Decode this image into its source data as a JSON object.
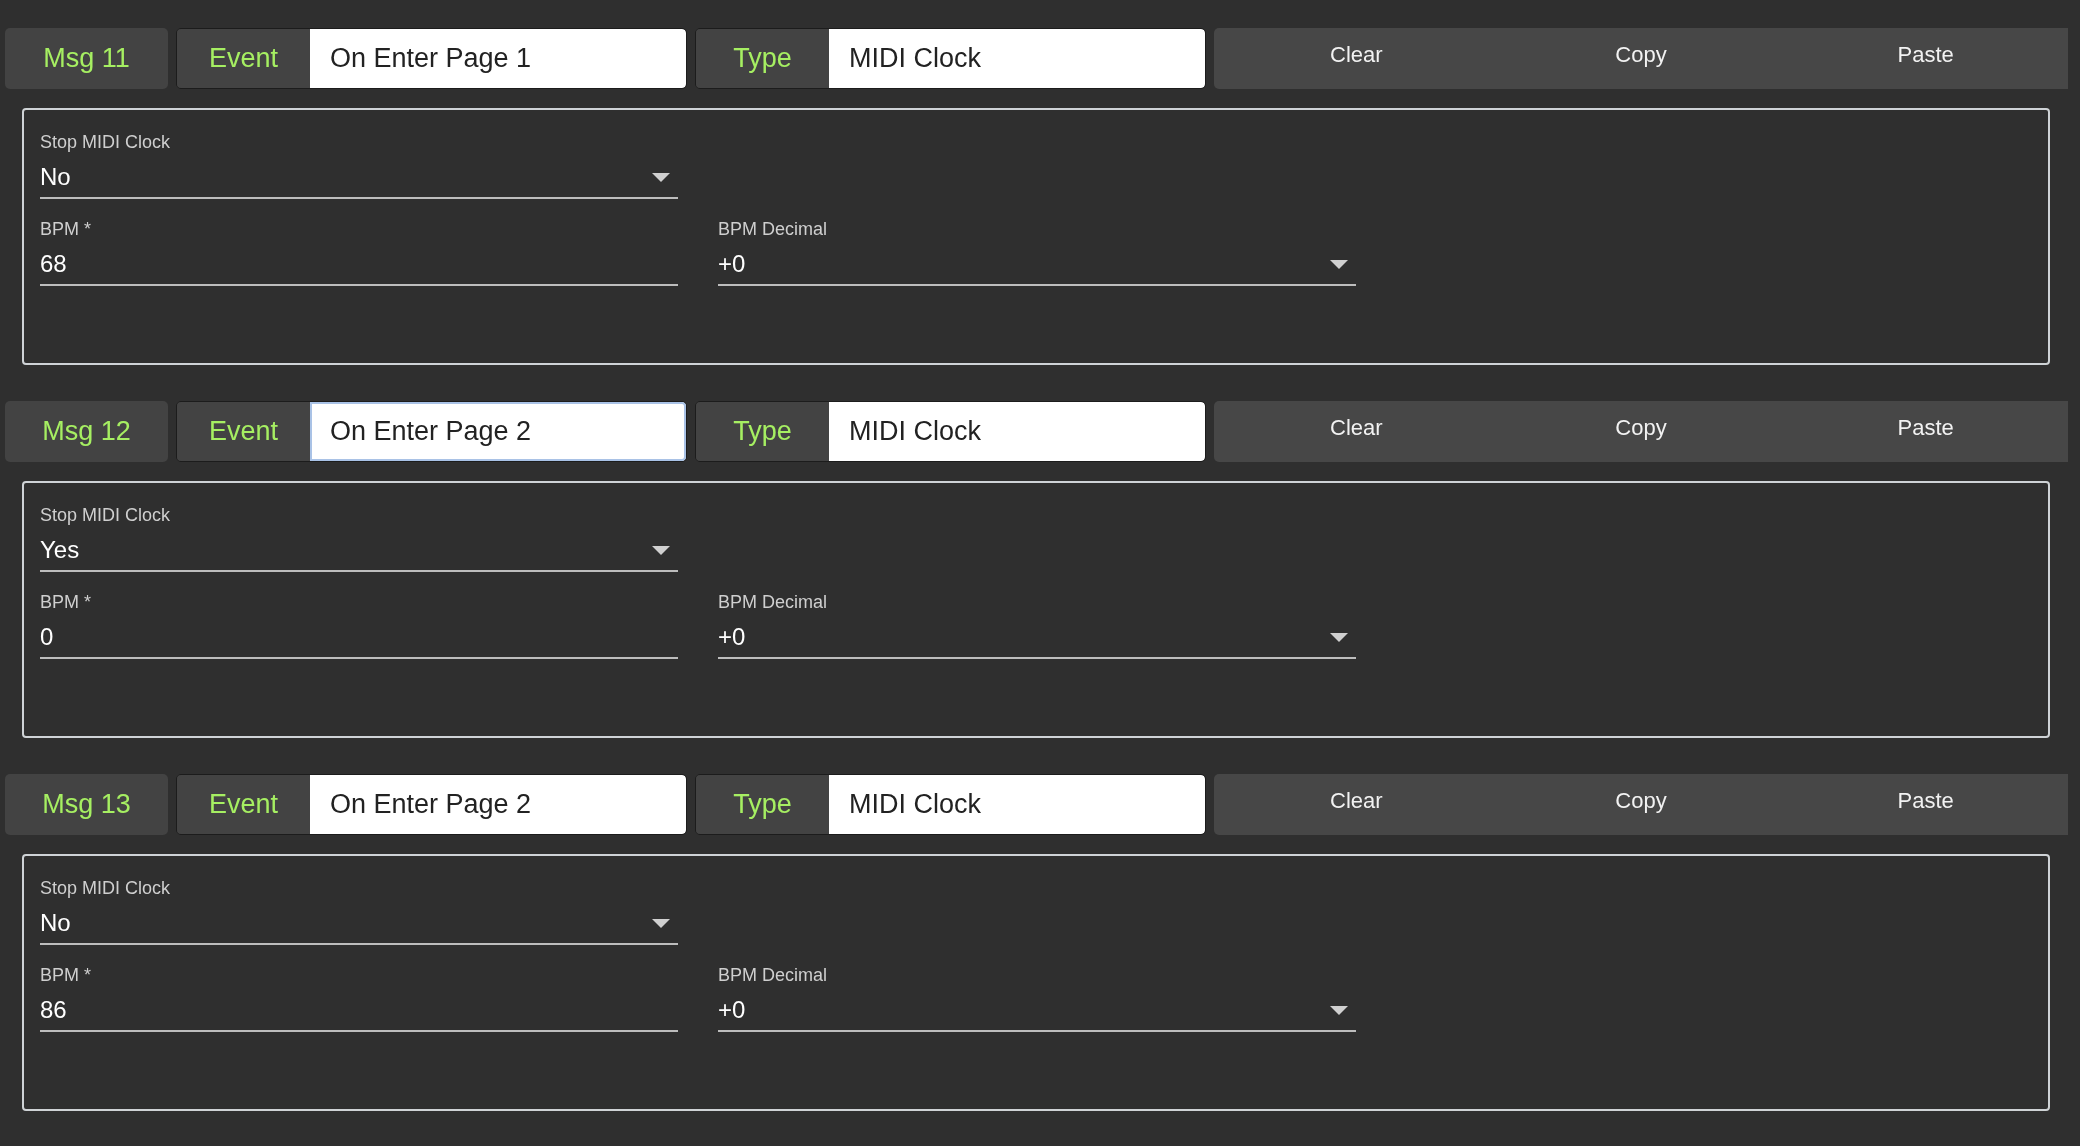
{
  "messages": [
    {
      "label": "Msg 11",
      "event_label": "Event",
      "event": {
        "value": "On Enter Page 1",
        "focused": false
      },
      "type_label": "Type",
      "type": {
        "value": "MIDI Clock",
        "focused": false
      },
      "buttons": [
        "Clear",
        "Copy",
        "Paste"
      ],
      "fields": [
        {
          "label": "Stop MIDI Clock",
          "value": "No",
          "kind": "select"
        },
        {
          "label": "BPM *",
          "value": "68",
          "kind": "text"
        },
        {
          "label": "BPM Decimal",
          "value": "+0",
          "kind": "select"
        }
      ]
    },
    {
      "label": "Msg 12",
      "event_label": "Event",
      "event": {
        "value": "On Enter Page 2",
        "focused": true
      },
      "type_label": "Type",
      "type": {
        "value": "MIDI Clock",
        "focused": false
      },
      "buttons": [
        "Clear",
        "Copy",
        "Paste"
      ],
      "fields": [
        {
          "label": "Stop MIDI Clock",
          "value": "Yes",
          "kind": "select"
        },
        {
          "label": "BPM *",
          "value": "0",
          "kind": "text"
        },
        {
          "label": "BPM Decimal",
          "value": "+0",
          "kind": "select"
        }
      ]
    },
    {
      "label": "Msg 13",
      "event_label": "Event",
      "event": {
        "value": "On Enter Page 2",
        "focused": false
      },
      "type_label": "Type",
      "type": {
        "value": "MIDI Clock",
        "focused": false
      },
      "buttons": [
        "Clear",
        "Copy",
        "Paste"
      ],
      "fields": [
        {
          "label": "Stop MIDI Clock",
          "value": "No",
          "kind": "select"
        },
        {
          "label": "BPM *",
          "value": "86",
          "kind": "text"
        },
        {
          "label": "BPM Decimal",
          "value": "+0",
          "kind": "select"
        }
      ]
    }
  ]
}
